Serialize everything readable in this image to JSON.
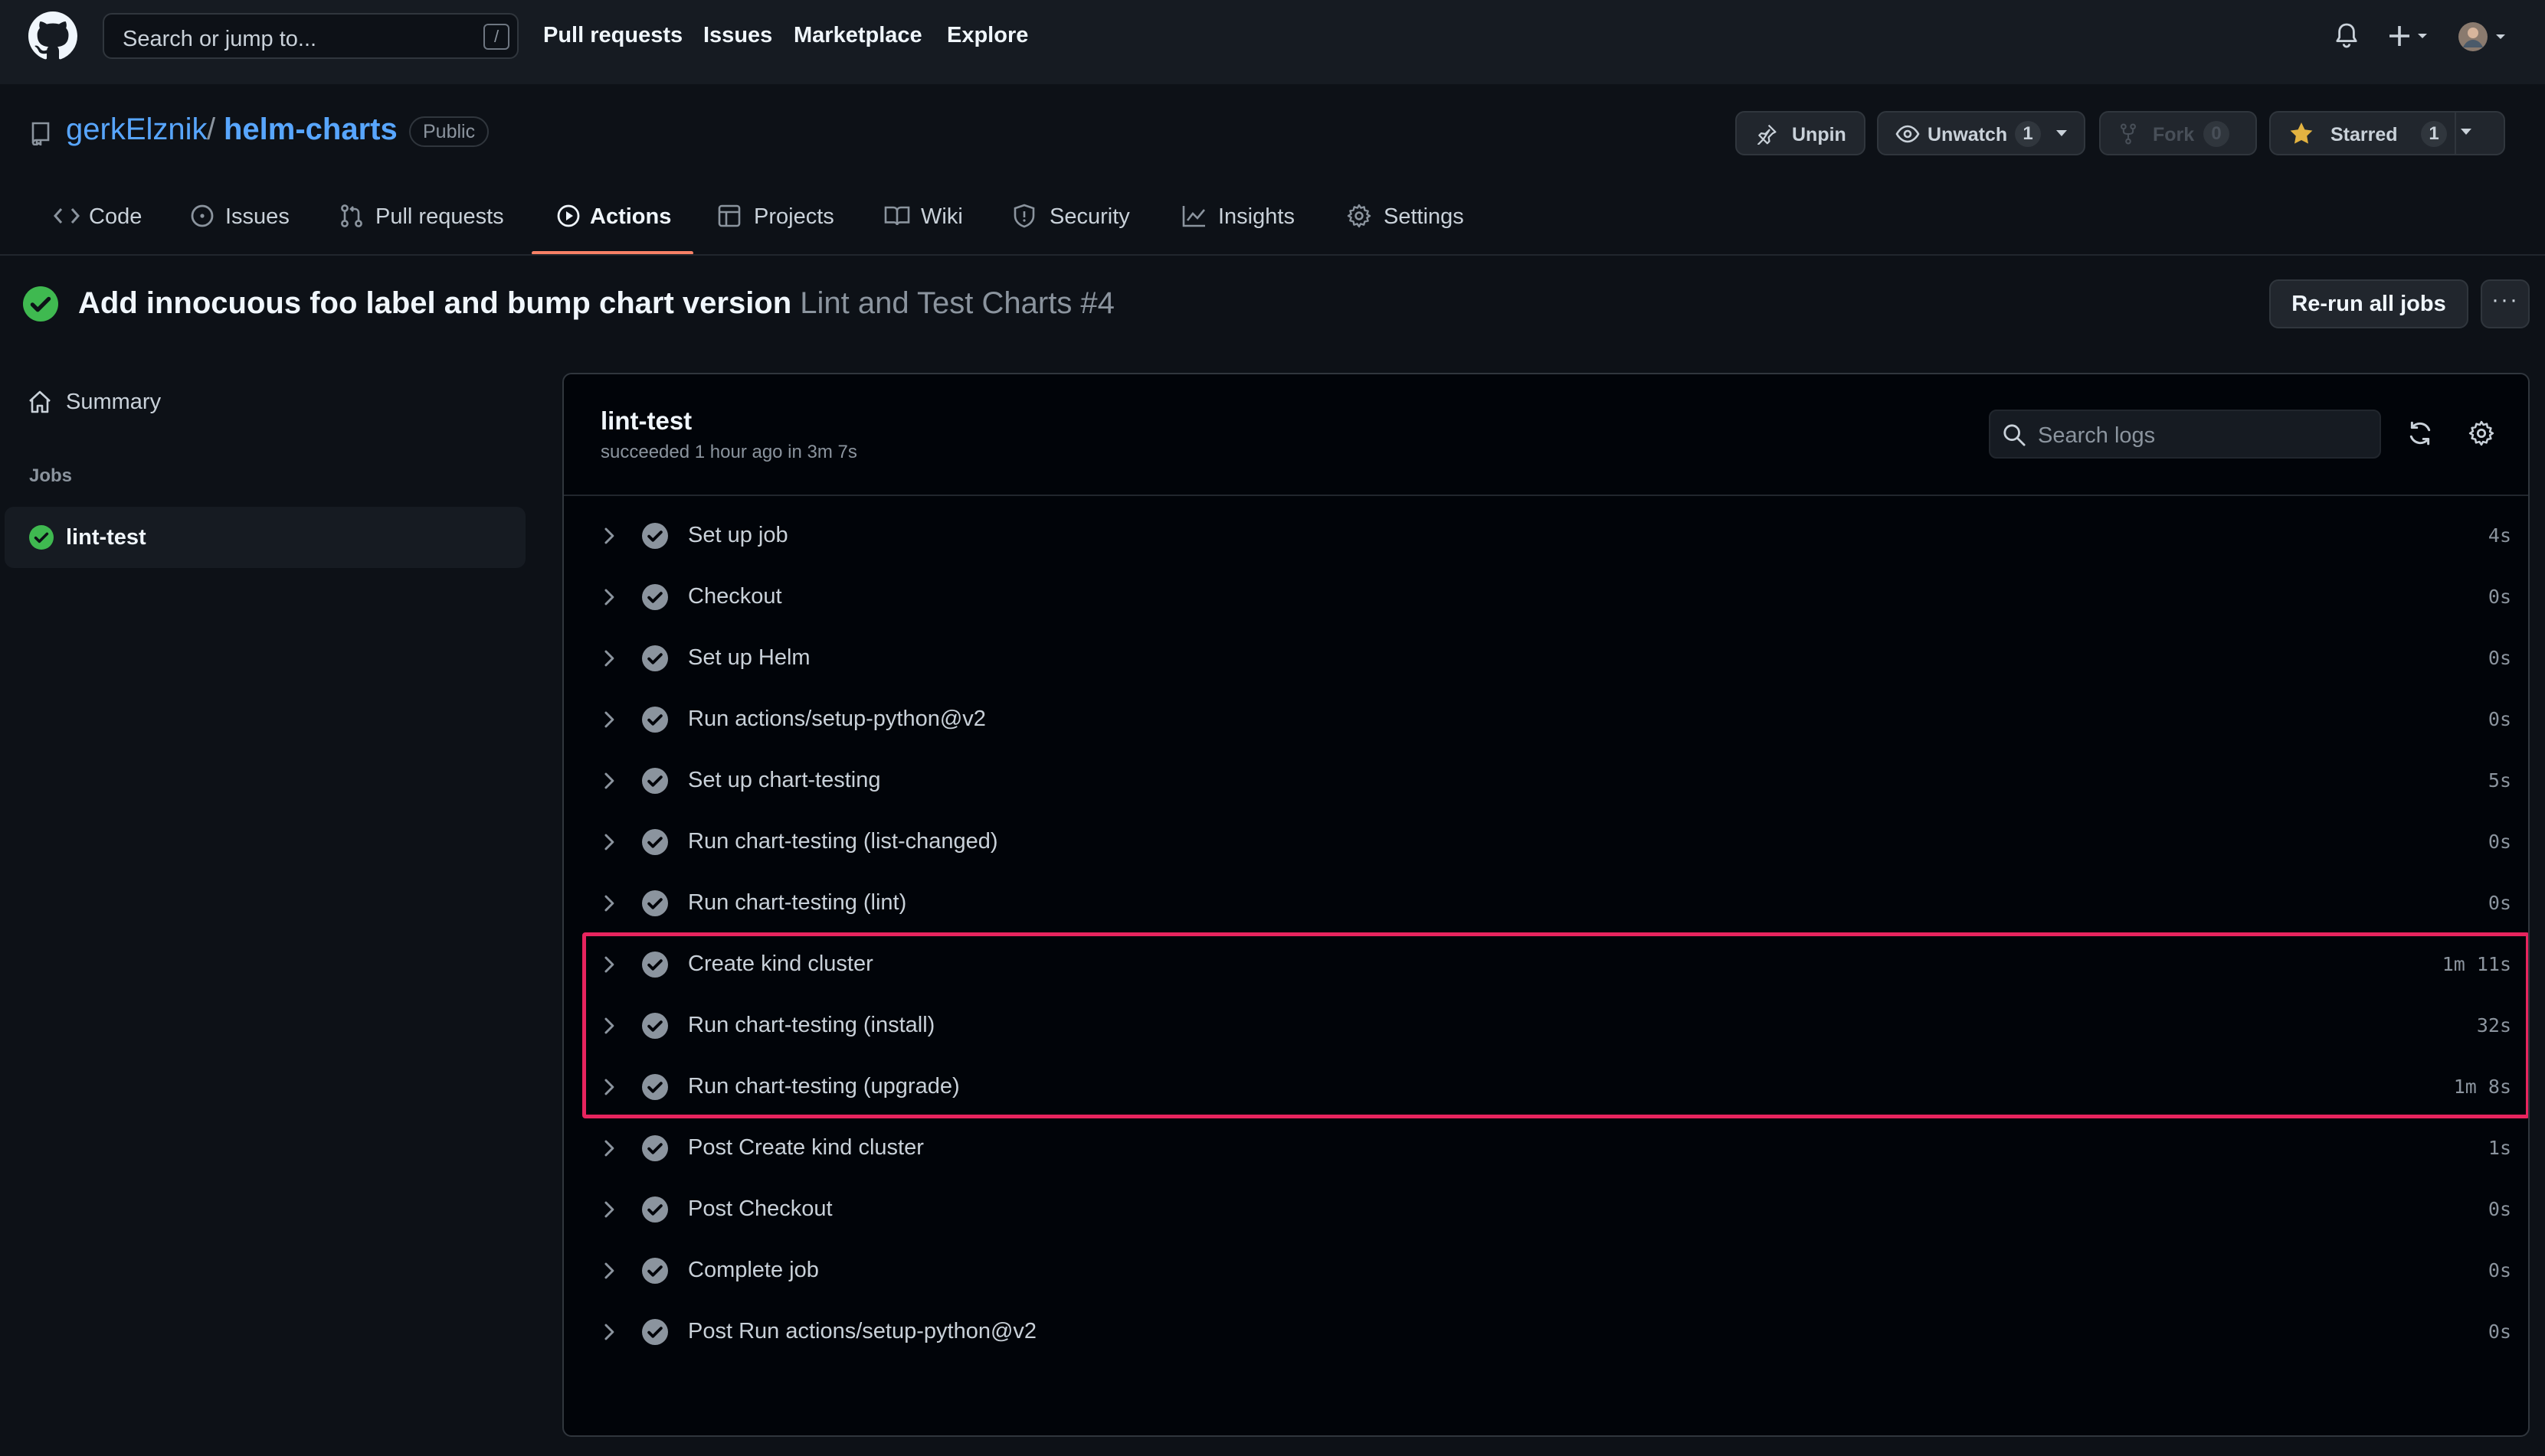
{
  "header": {
    "search_placeholder": "Search or jump to...",
    "search_shortcut": "/",
    "nav": [
      "Pull requests",
      "Issues",
      "Marketplace",
      "Explore"
    ]
  },
  "repo": {
    "owner": "gerkElznik",
    "separator": "/",
    "name": "helm-charts",
    "visibility": "Public",
    "unpin_label": "Unpin",
    "watch_label": "Unwatch",
    "watch_count": "1",
    "fork_label": "Fork",
    "fork_count": "0",
    "star_label": "Starred",
    "star_count": "1"
  },
  "tabs": [
    {
      "label": "Code",
      "icon": "code-icon"
    },
    {
      "label": "Issues",
      "icon": "issue-icon"
    },
    {
      "label": "Pull requests",
      "icon": "pull-request-icon"
    },
    {
      "label": "Actions",
      "icon": "play-icon",
      "active": true
    },
    {
      "label": "Projects",
      "icon": "table-icon"
    },
    {
      "label": "Wiki",
      "icon": "book-icon"
    },
    {
      "label": "Security",
      "icon": "shield-icon"
    },
    {
      "label": "Insights",
      "icon": "graph-icon"
    },
    {
      "label": "Settings",
      "icon": "gear-icon"
    }
  ],
  "run": {
    "title": "Add innocuous foo label and bump chart version",
    "workflow": "Lint and Test Charts #4",
    "rerun_label": "Re-run all jobs",
    "more_label": "···"
  },
  "sidebar": {
    "summary_label": "Summary",
    "jobs_heading": "Jobs",
    "jobs": [
      {
        "label": "lint-test",
        "status": "success"
      }
    ]
  },
  "job": {
    "name": "lint-test",
    "status_text": "succeeded 1 hour ago in 3m 7s",
    "search_placeholder": "Search logs",
    "steps": [
      {
        "name": "Set up job",
        "duration": "4s"
      },
      {
        "name": "Checkout",
        "duration": "0s"
      },
      {
        "name": "Set up Helm",
        "duration": "0s"
      },
      {
        "name": "Run actions/setup-python@v2",
        "duration": "0s"
      },
      {
        "name": "Set up chart-testing",
        "duration": "5s"
      },
      {
        "name": "Run chart-testing (list-changed)",
        "duration": "0s"
      },
      {
        "name": "Run chart-testing (lint)",
        "duration": "0s"
      },
      {
        "name": "Create kind cluster",
        "duration": "1m 11s"
      },
      {
        "name": "Run chart-testing (install)",
        "duration": "32s"
      },
      {
        "name": "Run chart-testing (upgrade)",
        "duration": "1m 8s"
      },
      {
        "name": "Post Create kind cluster",
        "duration": "1s"
      },
      {
        "name": "Post Checkout",
        "duration": "0s"
      },
      {
        "name": "Complete job",
        "duration": "0s"
      },
      {
        "name": "Post Run actions/setup-python@v2",
        "duration": "0s"
      }
    ]
  },
  "colors": {
    "accent_success": "#3fb950",
    "highlight": "#e8245e",
    "link": "#58a6ff",
    "tab_underline": "#f78166"
  }
}
